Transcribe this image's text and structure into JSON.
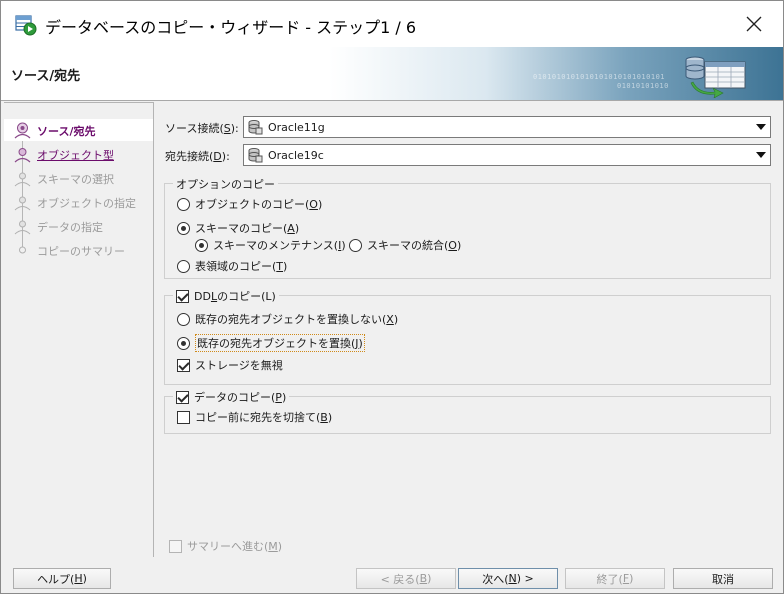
{
  "window": {
    "title": "データベースのコピー・ウィザード - ステップ1 / 6"
  },
  "banner": {
    "title": "ソース/宛先",
    "decor_digits_1": "0101010101010101010101010101",
    "decor_digits_2": "01010101010"
  },
  "nav": {
    "items": [
      {
        "label": "ソース/宛先",
        "state": "current"
      },
      {
        "label": "オブジェクト型",
        "state": "link"
      },
      {
        "label": "スキーマの選択",
        "state": "disabled"
      },
      {
        "label": "オブジェクトの指定",
        "state": "disabled"
      },
      {
        "label": "データの指定",
        "state": "disabled"
      },
      {
        "label": "コピーのサマリー",
        "state": "disabled"
      }
    ]
  },
  "connections": {
    "source_label": "ソース接続(",
    "source_mnemonic": "S",
    "source_label_end": "):",
    "source_value": "Oracle11g",
    "dest_label": "宛先接続(",
    "dest_mnemonic": "D",
    "dest_label_end": "):",
    "dest_value": "Oracle19c"
  },
  "copy_options": {
    "group_title": "オプションのコピー",
    "object_copy": {
      "text": "オブジェクトのコピー(",
      "mn": "O",
      "end": ")",
      "selected": false
    },
    "schema_copy": {
      "text": "スキーマのコピー(",
      "mn": "A",
      "end": ")",
      "selected": true
    },
    "schema_maintenance": {
      "text": "スキーマのメンテナンス(",
      "mn": "I",
      "end": ")",
      "selected": true
    },
    "schema_merge": {
      "text": "スキーマの統合(",
      "mn": "O",
      "end": ")",
      "selected": false
    },
    "tablespace_copy": {
      "text": "表領域のコピー(",
      "mn": "T",
      "end": ")",
      "selected": false
    }
  },
  "ddl": {
    "group_title_pre": "DD",
    "group_title_mn": "L",
    "group_title_post": "のコピー(L)",
    "checked": true,
    "no_replace": {
      "text": "既存の宛先オブジェクトを置換しない(",
      "mn": "X",
      "end": ")",
      "selected": false
    },
    "replace": {
      "text": "既存の宛先オブジェクトを置換(",
      "mn": "J",
      "end": ")",
      "selected": true
    },
    "ignore_storage": {
      "text": "ストレージを無視",
      "checked": true
    }
  },
  "data": {
    "group_title": "データのコピー(",
    "group_mn": "P",
    "group_end": ")",
    "checked": true,
    "truncate": {
      "text": "コピー前に宛先を切捨て(",
      "mn": "B",
      "end": ")",
      "checked": false
    }
  },
  "summary_checkbox": {
    "text": "サマリーへ進む(",
    "mn": "M",
    "end": ")",
    "checked": false,
    "enabled": false
  },
  "buttons": {
    "help": {
      "text": "ヘルプ(",
      "mn": "H",
      "end": ")"
    },
    "back": {
      "text": "< 戻る(",
      "mn": "B",
      "end": ")"
    },
    "next": {
      "text": "次へ(",
      "mn": "N",
      "end": ") >"
    },
    "finish": {
      "text": "終了(",
      "mn": "F",
      "end": ")"
    },
    "cancel": {
      "text": "取消"
    }
  },
  "colors": {
    "nav_current_text": "#6b0b6b",
    "focus_border": "#d08a1a",
    "banner_blue": "#3d7394"
  }
}
